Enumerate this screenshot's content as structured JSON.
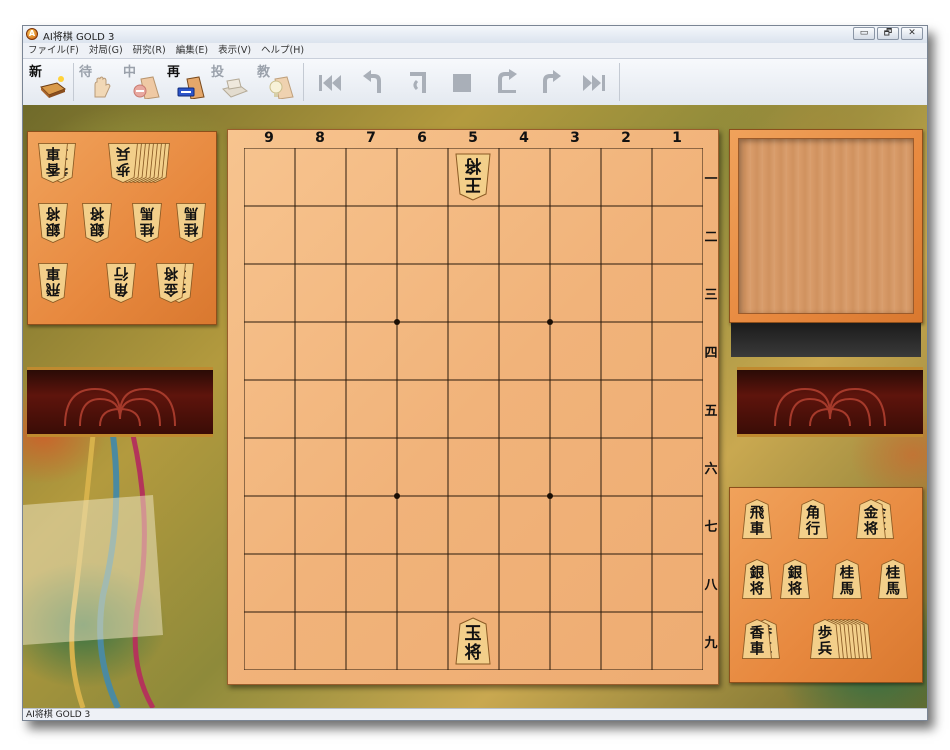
{
  "window": {
    "title": "AI将棋 GOLD 3",
    "controls": [
      "▭",
      "🗗",
      "✕"
    ]
  },
  "menu": {
    "items": [
      "ファイル(F)",
      "対局(G)",
      "研究(R)",
      "編集(E)",
      "表示(V)",
      "ヘルプ(H)"
    ]
  },
  "toolbar": {
    "buttons": [
      {
        "label": "新",
        "enabled": true
      },
      {
        "label": "待",
        "enabled": false
      },
      {
        "label": "中",
        "enabled": false
      },
      {
        "label": "再",
        "enabled": true
      },
      {
        "label": "投",
        "enabled": false
      },
      {
        "label": "教",
        "enabled": false
      }
    ],
    "nav": [
      "first-icon",
      "back-icon",
      "undo-icon",
      "stop-icon",
      "redo-icon",
      "forward-icon",
      "last-icon"
    ]
  },
  "board": {
    "files": [
      "9",
      "8",
      "7",
      "6",
      "5",
      "4",
      "3",
      "2",
      "1"
    ],
    "ranks": [
      "一",
      "二",
      "三",
      "四",
      "五",
      "六",
      "七",
      "八",
      "九"
    ],
    "pieces": [
      {
        "file": "5",
        "rank": "一",
        "top": "王",
        "bottom": "将",
        "owner": "gote"
      },
      {
        "file": "5",
        "rank": "九",
        "top": "玉",
        "bottom": "将",
        "owner": "sente"
      }
    ]
  },
  "gote_hand": {
    "pieces": [
      {
        "top": "香",
        "bottom": "車",
        "count": 2
      },
      {
        "top": "歩",
        "bottom": "兵",
        "count": 9
      },
      {
        "top": "銀",
        "bottom": "将",
        "count": 1
      },
      {
        "top": "銀",
        "bottom": "将",
        "count": 1
      },
      {
        "top": "桂",
        "bottom": "馬",
        "count": 1
      },
      {
        "top": "桂",
        "bottom": "馬",
        "count": 1
      },
      {
        "top": "飛",
        "bottom": "車",
        "count": 1
      },
      {
        "top": "角",
        "bottom": "行",
        "count": 1
      },
      {
        "top": "金",
        "bottom": "将",
        "count": 2
      }
    ]
  },
  "sente_hand": {
    "pieces": [
      {
        "top": "飛",
        "bottom": "車",
        "count": 1
      },
      {
        "top": "角",
        "bottom": "行",
        "count": 1
      },
      {
        "top": "金",
        "bottom": "将",
        "count": 2
      },
      {
        "top": "銀",
        "bottom": "将",
        "count": 1
      },
      {
        "top": "銀",
        "bottom": "将",
        "count": 1
      },
      {
        "top": "桂",
        "bottom": "馬",
        "count": 1
      },
      {
        "top": "桂",
        "bottom": "馬",
        "count": 1
      },
      {
        "top": "香",
        "bottom": "車",
        "count": 2
      },
      {
        "top": "歩",
        "bottom": "兵",
        "count": 9
      }
    ]
  },
  "status": {
    "text": "AI将棋 GOLD 3"
  }
}
